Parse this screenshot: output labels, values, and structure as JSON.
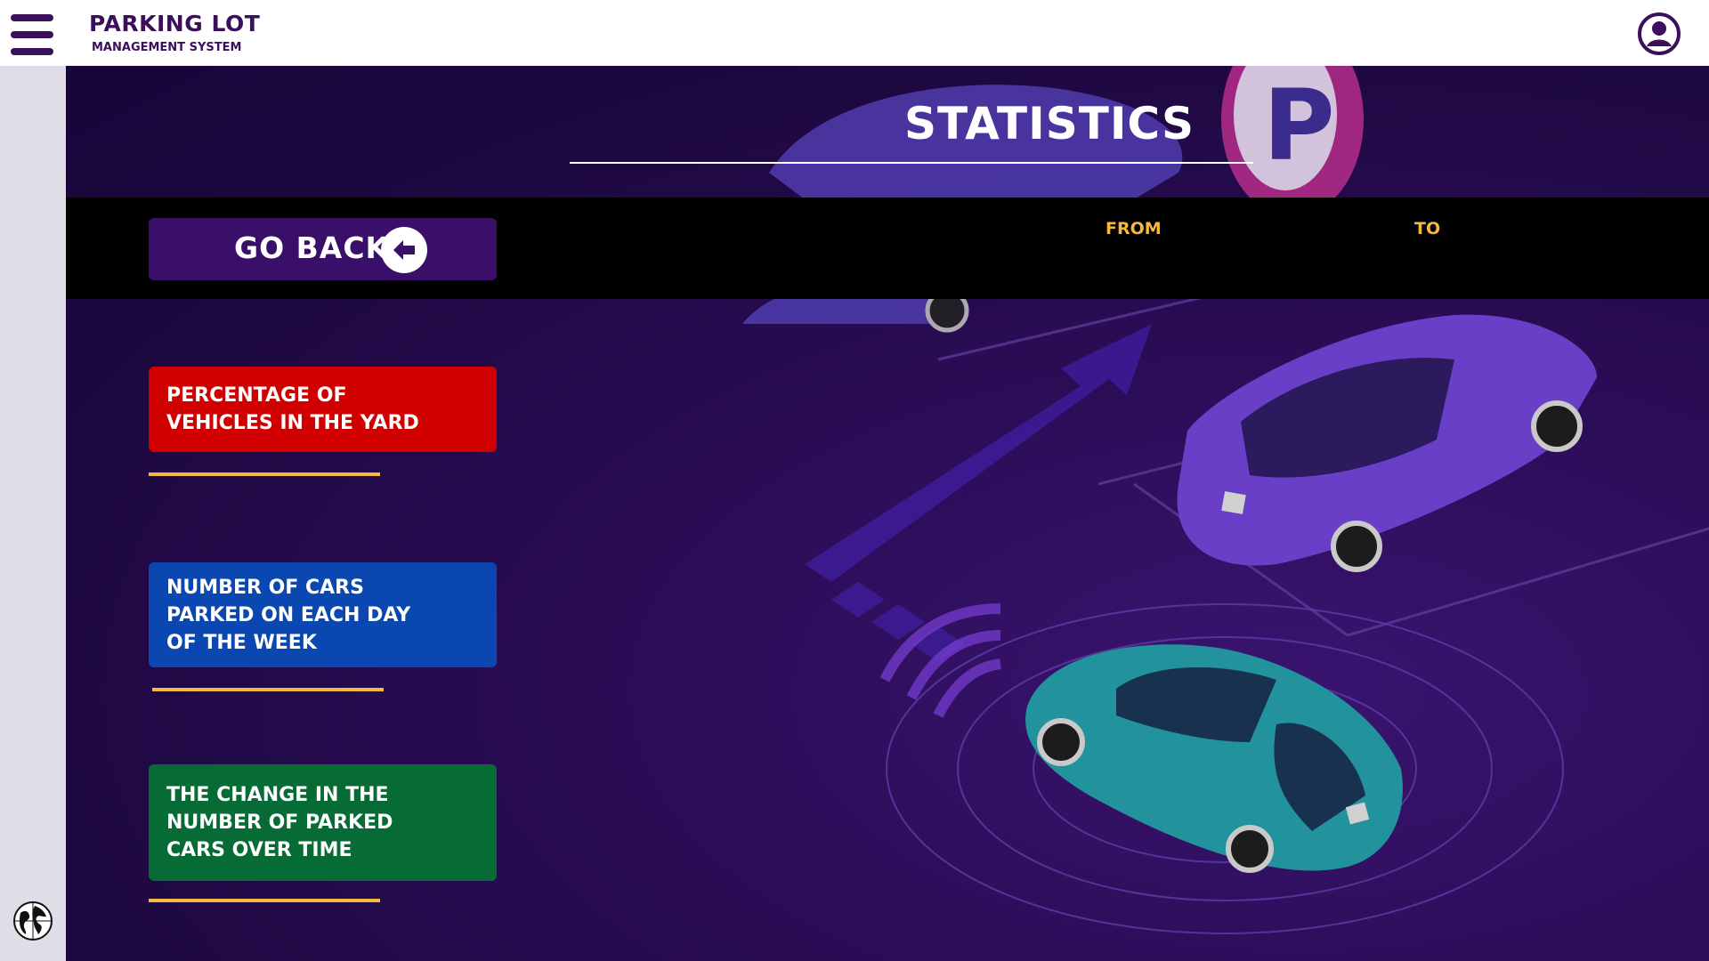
{
  "header": {
    "brand_title": "PARKING LOT",
    "brand_subtitle": "MANAGEMENT SYSTEM",
    "menu_icon": "hamburger-menu-icon",
    "user_icon": "user-avatar-icon"
  },
  "page": {
    "title": "STATISTICS"
  },
  "toolbar": {
    "go_back_label": "GO BACK",
    "go_back_icon": "arrow-left-circle-icon",
    "from_label": "FROM",
    "to_label": "TO"
  },
  "stats_buttons": [
    {
      "label": "PERCENTAGE OF VEHICLES IN THE YARD",
      "color": "#d00000"
    },
    {
      "label": "NUMBER OF CARS PARKED ON EACH DAY OF THE WEEK",
      "color": "#0b47b0"
    },
    {
      "label": "THE CHANGE IN THE NUMBER OF PARKED CARS OVER TIME",
      "color": "#066b35"
    }
  ],
  "sidebar": {
    "globe_icon": "globe-icon"
  },
  "colors": {
    "brand": "#3b0f5c",
    "accent": "#f5b841",
    "background": "#1d0840"
  }
}
